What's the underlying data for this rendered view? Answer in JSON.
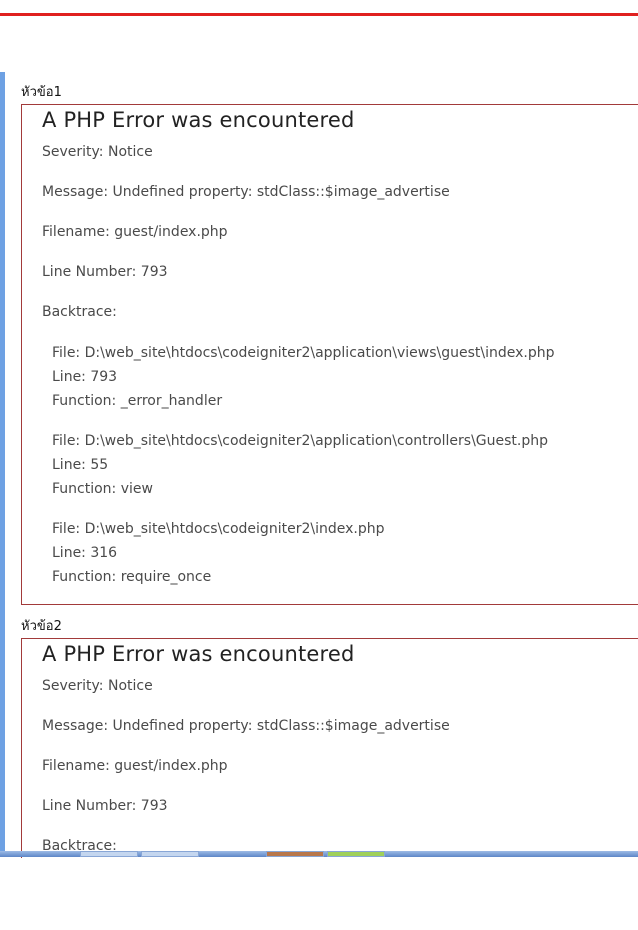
{
  "sections": [
    {
      "label": "หัวข้อ1",
      "title": "A PHP Error was encountered",
      "severity": "Severity: Notice",
      "message": "Message: Undefined property: stdClass::$image_advertise",
      "filename": "Filename: guest/index.php",
      "line_number": "Line Number: 793",
      "backtrace_label": "Backtrace:",
      "traces": [
        {
          "file": "File: D:\\web_site\\htdocs\\codeigniter2\\application\\views\\guest\\index.php",
          "line": "Line: 793",
          "function": "Function: _error_handler"
        },
        {
          "file": "File: D:\\web_site\\htdocs\\codeigniter2\\application\\controllers\\Guest.php",
          "line": "Line: 55",
          "function": "Function: view"
        },
        {
          "file": "File: D:\\web_site\\htdocs\\codeigniter2\\index.php",
          "line": "Line: 316",
          "function": "Function: require_once"
        }
      ]
    },
    {
      "label": "หัวข้อ2",
      "title": "A PHP Error was encountered",
      "severity": "Severity: Notice",
      "message": "Message: Undefined property: stdClass::$image_advertise",
      "filename": "Filename: guest/index.php",
      "line_number": "Line Number: 793",
      "backtrace_label": "Backtrace:"
    }
  ],
  "colors": {
    "accent_bar": "#e0201f",
    "box_border": "#a23a3a",
    "left_rail": "#6ea1e3"
  }
}
